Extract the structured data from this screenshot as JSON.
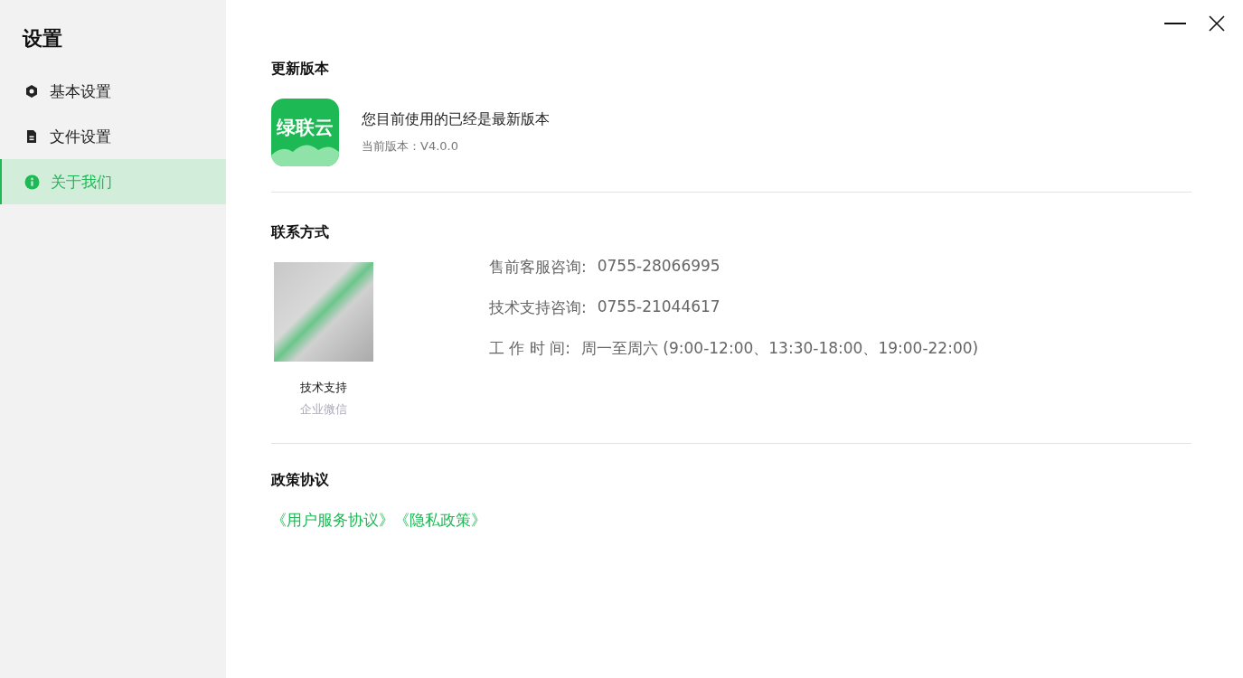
{
  "sidebar": {
    "title": "设置",
    "items": [
      {
        "label": "基本设置",
        "kind": "general",
        "selected": false
      },
      {
        "label": "文件设置",
        "kind": "file",
        "selected": false
      },
      {
        "label": "关于我们",
        "kind": "info",
        "selected": true
      }
    ]
  },
  "update": {
    "heading": "更新版本",
    "logo_text": "绿联云",
    "status": "您目前使用的已经是最新版本",
    "version": "当前版本：V4.0.0"
  },
  "contact": {
    "heading": "联系方式",
    "qr_caption": "技术支持",
    "qr_sub": "企业微信",
    "rows": [
      {
        "label": "售前客服咨询:",
        "value": "0755-28066995"
      },
      {
        "label": "技术支持咨询:",
        "value": "0755-21044617"
      },
      {
        "label": "工 作 时 间:",
        "value": "周一至周六 (9:00-12:00、13:30-18:00、19:00-22:00)"
      }
    ]
  },
  "policy": {
    "heading": "政策协议",
    "links": [
      "《用户服务协议》",
      "《隐私政策》"
    ]
  }
}
